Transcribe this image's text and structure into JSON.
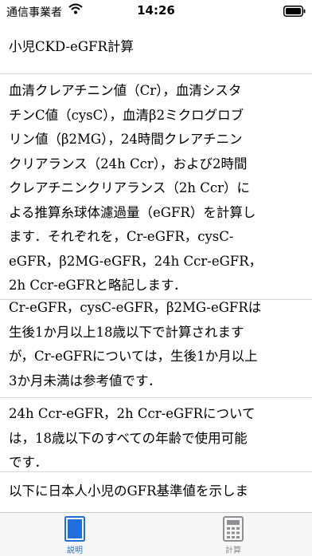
{
  "status_bar": {
    "carrier": "通信事業者",
    "time": "14:26"
  },
  "page": {
    "title": "小児CKD-eGFR計算",
    "paragraphs": [
      {
        "lines": [
          "血清クレアチニン値（Cr），血清シスタ",
          "チンC値（cysC），血清β2ミクログロブ",
          "リン値（β2MG），24時間クレアチニン",
          "クリアランス（24h Ccr），および2時間",
          "クレアチニンクリアランス（2h Ccr）に",
          "よる推算糸球体濾過量（eGFR）を計算し",
          "ます．それぞれを，Cr-eGFR，cysC-",
          "eGFR，β2MG-eGFR，24h Ccr-eGFR，",
          "2h Ccr-eGFRと略記します．"
        ]
      },
      {
        "lines": [
          "Cr-eGFR，cysC-eGFR，β2MG-eGFRは",
          "生後1か月以上18歳以下で計算されます",
          "が，Cr-eGFRについては，生後1か月以上",
          "3か月未満は参考値です．"
        ]
      },
      {
        "lines": [
          "24h Ccr-eGFR，2h Ccr-eGFRについて",
          "は，18歳以下のすべての年齢で使用可能",
          "です．"
        ]
      },
      {
        "lines": [
          "以下に日本人小児のGFR基準値を示しま"
        ]
      }
    ]
  },
  "tab_bar": {
    "tabs": [
      {
        "label": "説明",
        "icon": "book-icon",
        "active": true
      },
      {
        "label": "計算",
        "icon": "calculator-icon",
        "active": false
      }
    ],
    "active_color": "#1f6fe0",
    "inactive_color": "#8e8e93"
  }
}
